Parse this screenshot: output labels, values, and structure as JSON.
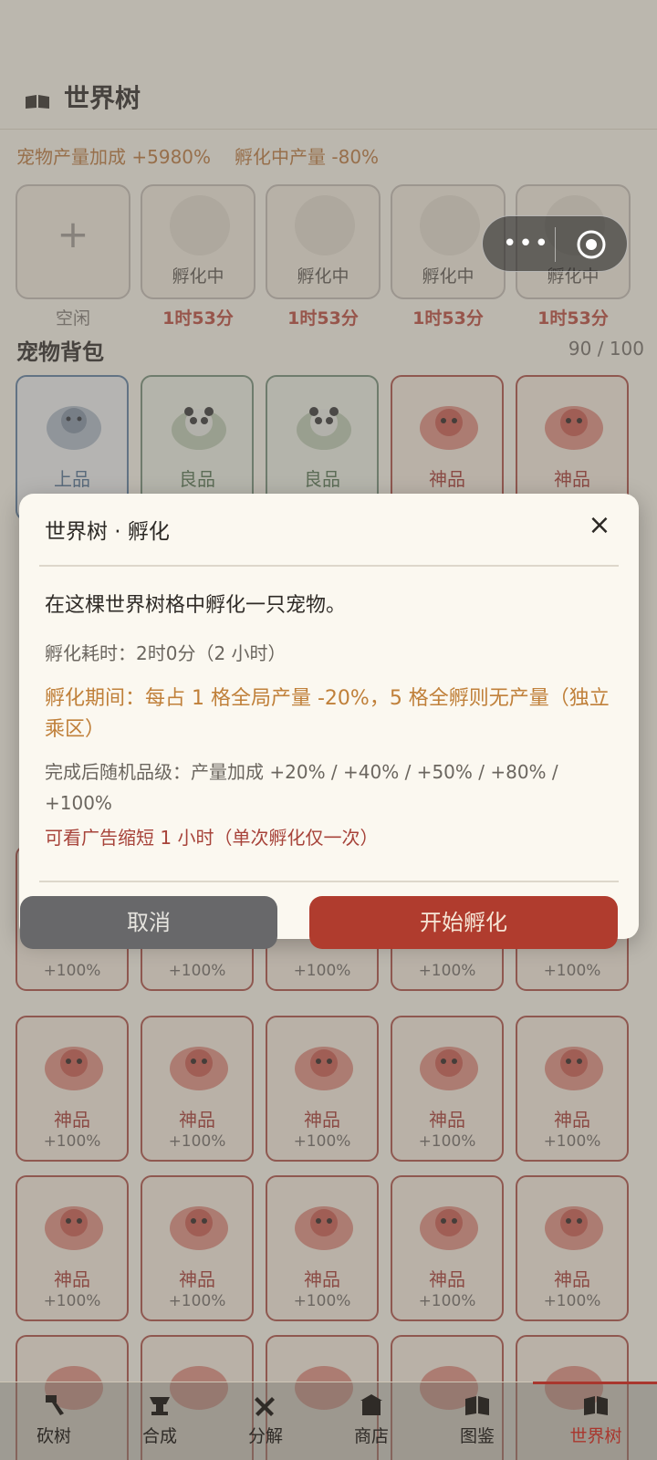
{
  "header": {
    "title": "世界树",
    "icon": "book-icon"
  },
  "stats": {
    "pet_bonus": "宠物产量加成 +5980%",
    "hatching_output": "孵化中产量 -80%"
  },
  "slots": [
    {
      "symbol": "+",
      "status": "",
      "label": "空闲"
    },
    {
      "symbol": "",
      "status": "孵化中",
      "label": "1时53分"
    },
    {
      "symbol": "",
      "status": "孵化中",
      "label": "1时53分"
    },
    {
      "symbol": "",
      "status": "孵化中",
      "label": "1时53分"
    },
    {
      "symbol": "",
      "status": "孵化中",
      "label": "1时53分"
    }
  ],
  "capsule": {
    "more_icon": "more-dots-icon",
    "close_icon": "target-icon"
  },
  "bag": {
    "title": "宠物背包",
    "count": "90 / 100"
  },
  "pets_row1": [
    {
      "grade": "上品",
      "bonus": "",
      "kind": "blue"
    },
    {
      "grade": "良品",
      "bonus": "",
      "kind": "green"
    },
    {
      "grade": "良品",
      "bonus": "",
      "kind": "green"
    },
    {
      "grade": "神品",
      "bonus": "",
      "kind": "red"
    },
    {
      "grade": "神品",
      "bonus": "",
      "kind": "red"
    }
  ],
  "pets_row_partial": [
    {
      "grade": "",
      "bonus": "+100%"
    },
    {
      "grade": "",
      "bonus": "+100%"
    },
    {
      "grade": "",
      "bonus": "+100%"
    },
    {
      "grade": "",
      "bonus": "+100%"
    },
    {
      "grade": "",
      "bonus": "+100%"
    }
  ],
  "pets_row3": [
    {
      "grade": "神品",
      "bonus": "+100%"
    },
    {
      "grade": "神品",
      "bonus": "+100%"
    },
    {
      "grade": "神品",
      "bonus": "+100%"
    },
    {
      "grade": "神品",
      "bonus": "+100%"
    },
    {
      "grade": "神品",
      "bonus": "+100%"
    }
  ],
  "pets_row4": [
    {
      "grade": "神品",
      "bonus": "+100%"
    },
    {
      "grade": "神品",
      "bonus": "+100%"
    },
    {
      "grade": "神品",
      "bonus": "+100%"
    },
    {
      "grade": "神品",
      "bonus": "+100%"
    },
    {
      "grade": "神品",
      "bonus": "+100%"
    }
  ],
  "dialog": {
    "title": "世界树 · 孵化",
    "close": "×",
    "intro": "在这棵世界树格中孵化一只宠物。",
    "cost": "孵化耗时：2时0分（2 小时）",
    "warning": "孵化期间：每占 1 格全局产量 -20%，5 格全孵则无产量（独立乘区）",
    "grades": "完成后随机品级：产量加成 +20% / +40% / +50% / +80% / +100%",
    "ad_note": "可看广告缩短 1 小时（单次孵化仅一次）",
    "cancel": "取消",
    "start": "开始孵化"
  },
  "nav": [
    {
      "label": "砍树",
      "icon": "axe-icon"
    },
    {
      "label": "合成",
      "icon": "anvil-icon"
    },
    {
      "label": "分解",
      "icon": "tools-icon"
    },
    {
      "label": "商店",
      "icon": "shop-icon"
    },
    {
      "label": "图鉴",
      "icon": "book-icon"
    },
    {
      "label": "世界树",
      "icon": "book-icon"
    }
  ],
  "colors": {
    "accent": "#a9372e",
    "gold": "#c0803a",
    "red_border": "#a74c42"
  }
}
